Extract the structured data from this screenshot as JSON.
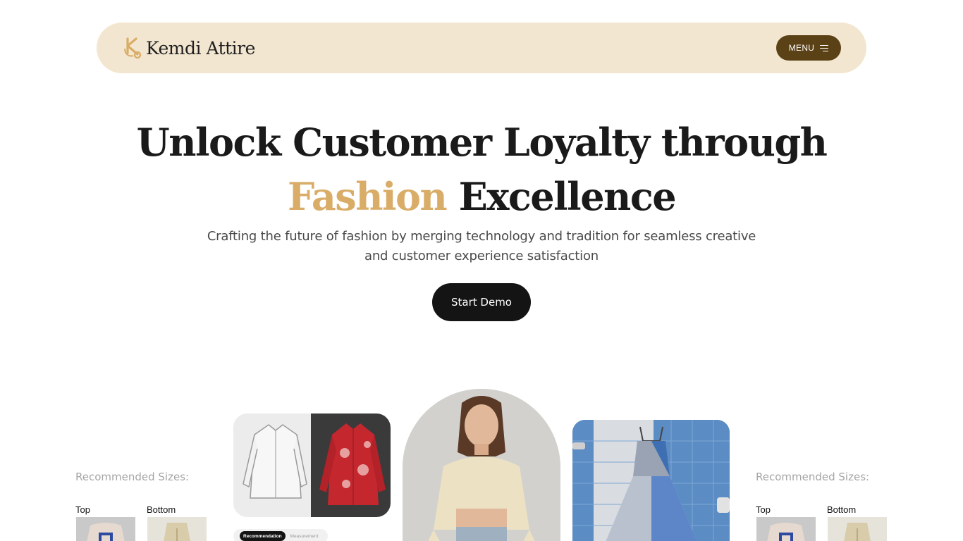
{
  "nav": {
    "brand_name": "Kemdi Attire",
    "menu_label": "MENU",
    "colors": {
      "bar": "#f2e6d0",
      "menu_button": "#5b4116",
      "logo": "#d9ad68"
    }
  },
  "hero": {
    "title_line1": "Unlock Customer Loyalty through",
    "title_accent": "Fashion",
    "title_rest": "Excellence",
    "subtitle": "Crafting the future of fashion by merging technology and tradition for seamless creative and customer experience satisfaction",
    "cta_label": "Start Demo",
    "accent_color": "#d9ad68"
  },
  "recommendations": {
    "left": {
      "title": "Recommended Sizes:",
      "top_label": "Top",
      "bottom_label": "Bottom"
    },
    "right": {
      "title": "Recommended Sizes:",
      "top_label": "Top",
      "bottom_label": "Bottom"
    }
  },
  "cards": {
    "toggle": {
      "active": "Recommendation",
      "inactive": "Measurement"
    }
  }
}
